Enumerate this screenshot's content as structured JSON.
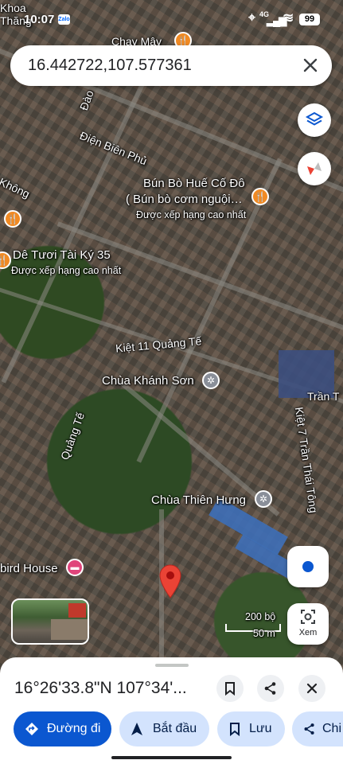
{
  "status": {
    "time": "10:07",
    "network": "4G",
    "battery": "99"
  },
  "search": {
    "value": "16.442722,107.577361"
  },
  "map": {
    "labels": {
      "khoa_thang": "Khoa\nThăng",
      "chay_may": "Chay Mây",
      "dao": "Đào",
      "dien_bien_phu": "Điện Biên Phủ",
      "khong": "Không",
      "bun_bo_title": "Bún Bò Huế Cố Đô",
      "bun_bo_sub": "( Bún bò cơm nguội…",
      "bun_bo_rating": "Được xếp hạng cao nhất",
      "de_tuoi_title": "Dê Tươi Tài Ký 35",
      "de_tuoi_rating": "Được xếp hạng cao nhất",
      "kiet11": "Kiệt 11 Quảng Tế",
      "chua_khanh_son": "Chùa Khánh Sơn",
      "tran_t": "Trần T",
      "kiet7": "Kiệt 7 Trần Thái Tông",
      "quang_te": "Quảng Tế",
      "chua_thien_hung": "Chùa Thiên Hưng",
      "bird_house": "bird House"
    },
    "scale": {
      "imperial": "200 bộ",
      "metric": "50 m"
    },
    "lens_label": "Xem"
  },
  "sheet": {
    "coordinates": "16°26'33.8\"N 107°34'...",
    "actions": {
      "directions": "Đường đi",
      "start": "Bắt đầu",
      "save": "Lưu",
      "share": "Chi"
    }
  },
  "colors": {
    "primary": "#0b57d0",
    "chip_bg": "#d3e3fd",
    "pin_red": "#ea4335"
  }
}
